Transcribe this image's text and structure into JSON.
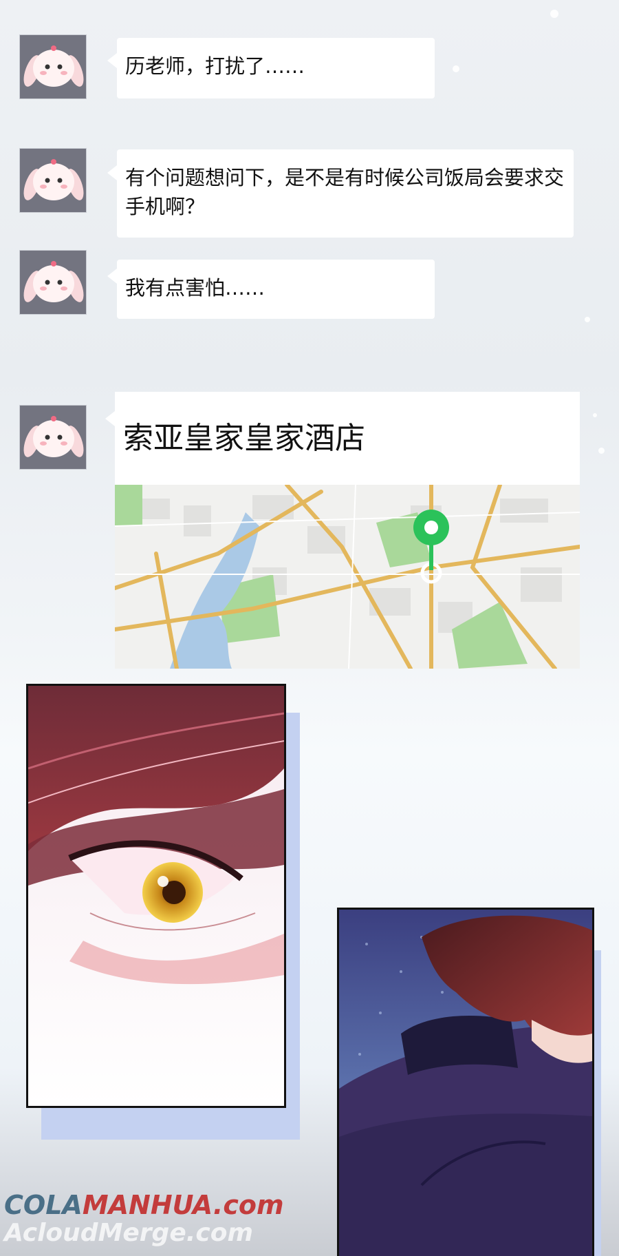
{
  "messages": [
    {
      "text": "历老师，打扰了……"
    },
    {
      "text": "有个问题想问下，是不是有时候公司饭局会要求交手机啊？"
    },
    {
      "text": "我有点害怕……"
    }
  ],
  "location": {
    "name": "索亚皇家皇家酒店"
  },
  "watermark": {
    "line1_a": "COLA",
    "line1_b": "MANHUA.com",
    "line2": "AcloudMerge.com"
  },
  "colors": {
    "bubble": "#ffffff",
    "pin": "#2bc25a",
    "map_road": "#e3b75c",
    "map_park": "#a9d89a",
    "map_water": "#aac9e6"
  }
}
